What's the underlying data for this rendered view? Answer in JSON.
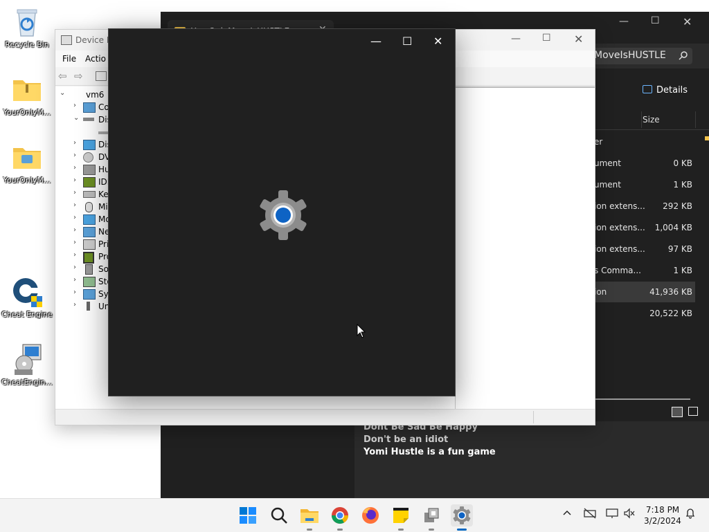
{
  "desktop": {
    "icons": [
      {
        "label": "Recycle Bin"
      },
      {
        "label": "YourOnlyM..."
      },
      {
        "label": "YourOnlyM..."
      },
      {
        "label": "Cheat Engine"
      },
      {
        "label": "CheatEngin..."
      }
    ]
  },
  "explorer": {
    "tab_title": "YourOnlyMoveIsHUSTLE",
    "search_text": "MoveIsHUSTLE",
    "details_label": "Details",
    "size_header": "Size",
    "rows": [
      {
        "type": "er",
        "size": ""
      },
      {
        "type": "ument",
        "size": "0 KB"
      },
      {
        "type": "ument",
        "size": "1 KB"
      },
      {
        "type": "ion extens...",
        "size": "292 KB"
      },
      {
        "type": "ion extens...",
        "size": "1,004 KB"
      },
      {
        "type": "ion extens...",
        "size": "97 KB"
      },
      {
        "type": "s Comma...",
        "size": "1 KB"
      },
      {
        "type": "ion",
        "size": "41,936 KB"
      },
      {
        "type": "",
        "size": "20,522 KB"
      }
    ],
    "preview_lines": [
      "Dont Be Sad Be Happy",
      "Don't be an idiot",
      "Yomi Hustle is a fun game"
    ]
  },
  "devmgr": {
    "title": "Device M",
    "menu": [
      "File",
      "Actio"
    ],
    "tree": [
      {
        "label": "vm6",
        "arrow": "down",
        "indent": 0
      },
      {
        "label": "Co",
        "arrow": "right",
        "indent": 1
      },
      {
        "label": "Dis",
        "arrow": "down",
        "indent": 1
      },
      {
        "label": "",
        "arrow": "none",
        "indent": 2
      },
      {
        "label": "Dis",
        "arrow": "right",
        "indent": 1
      },
      {
        "label": "DV",
        "arrow": "right",
        "indent": 1
      },
      {
        "label": "Hu",
        "arrow": "right",
        "indent": 1
      },
      {
        "label": "IDI",
        "arrow": "right",
        "indent": 1
      },
      {
        "label": "Ke",
        "arrow": "right",
        "indent": 1
      },
      {
        "label": "Mi",
        "arrow": "right",
        "indent": 1
      },
      {
        "label": "Mo",
        "arrow": "right",
        "indent": 1
      },
      {
        "label": "Ne",
        "arrow": "right",
        "indent": 1
      },
      {
        "label": "Pri",
        "arrow": "right",
        "indent": 1
      },
      {
        "label": "Pro",
        "arrow": "right",
        "indent": 1
      },
      {
        "label": "So",
        "arrow": "right",
        "indent": 1
      },
      {
        "label": "Sto",
        "arrow": "right",
        "indent": 1
      },
      {
        "label": "Sy",
        "arrow": "right",
        "indent": 1
      },
      {
        "label": "Un",
        "arrow": "right",
        "indent": 1
      }
    ]
  },
  "splash": {
    "icon": "settings-gear-icon"
  },
  "taskbar": {
    "apps": [
      "start-icon",
      "search-icon",
      "file-explorer-icon",
      "chrome-icon",
      "firefox-icon",
      "sticky-notes-icon",
      "app-icon",
      "settings-icon"
    ],
    "time": "7:18 PM",
    "date": "3/2/2024"
  },
  "colors": {
    "accent": "#0067c0",
    "dark_bg": "#202020"
  }
}
